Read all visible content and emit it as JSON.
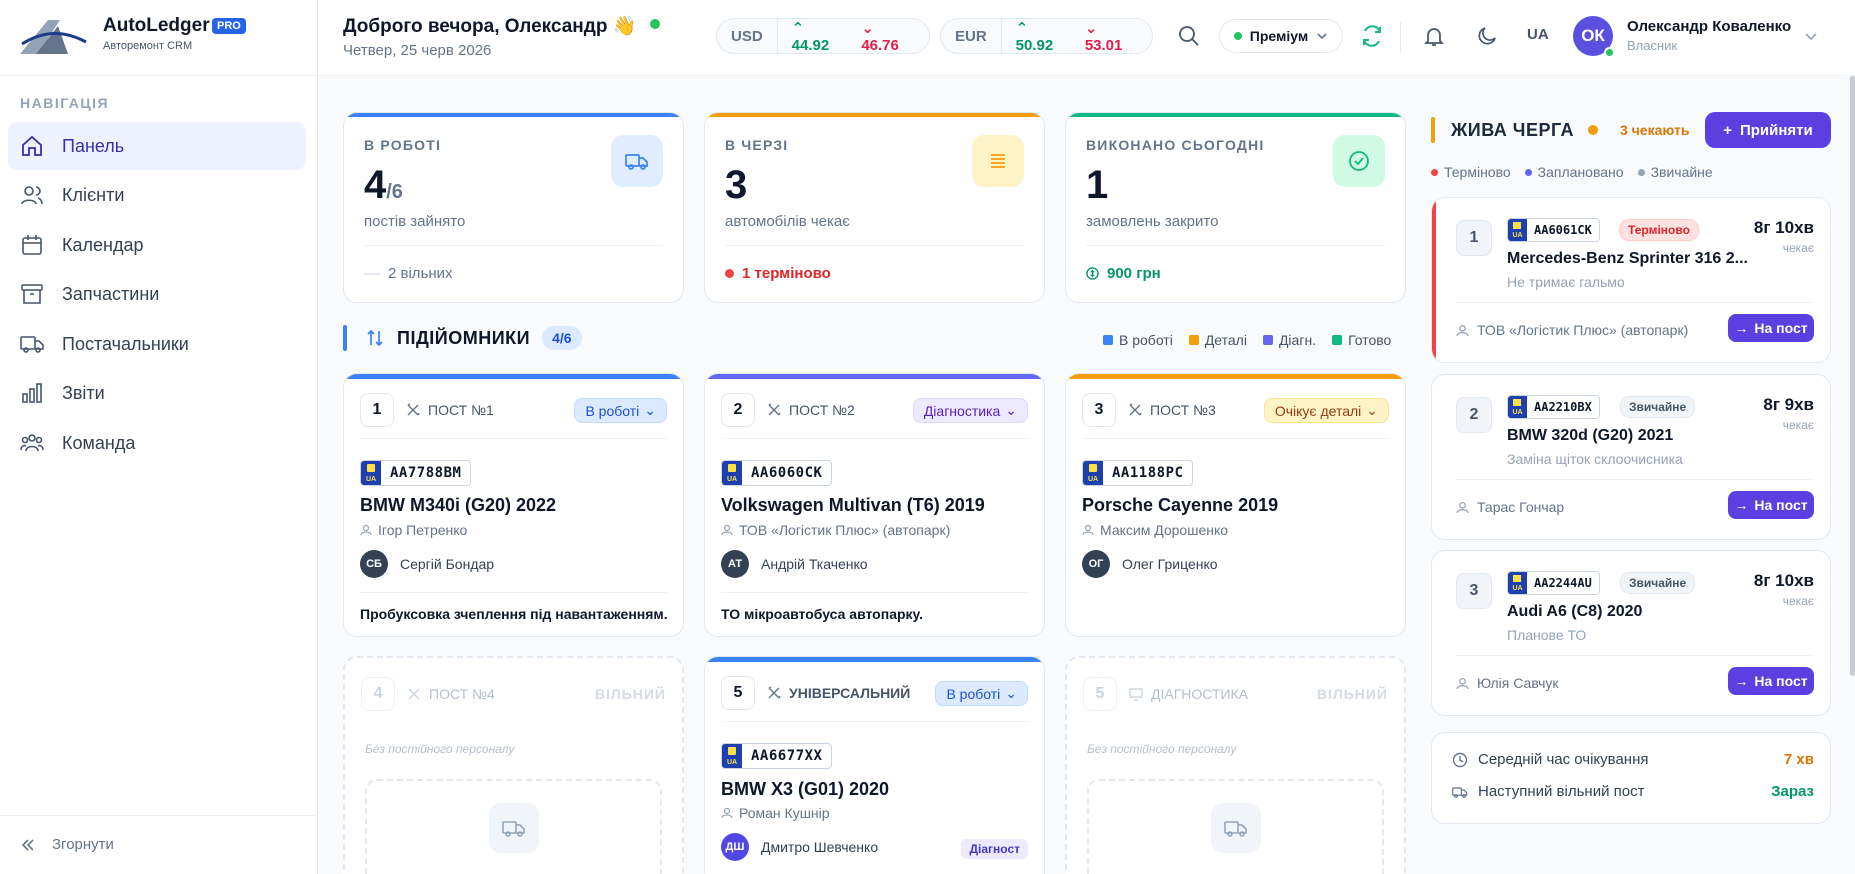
{
  "app": {
    "name": "AutoLedger",
    "badge": "PRO",
    "subtitle": "Авторемонт CRM"
  },
  "sidebar": {
    "heading": "НАВІГАЦІЯ",
    "items": [
      {
        "label": "Панель",
        "icon": "home-icon"
      },
      {
        "label": "Клієнти",
        "icon": "users-icon"
      },
      {
        "label": "Календар",
        "icon": "calendar-icon"
      },
      {
        "label": "Запчастини",
        "icon": "archive-icon"
      },
      {
        "label": "Постачальники",
        "icon": "truck-icon"
      },
      {
        "label": "Звіти",
        "icon": "chart-icon"
      },
      {
        "label": "Команда",
        "icon": "team-icon"
      }
    ],
    "collapse": "Згорнути"
  },
  "header": {
    "greeting": "Доброго вечора, Олександр",
    "wave": "👋",
    "date": "Четвер, 25 черв 2026",
    "rates": [
      {
        "code": "USD",
        "buy": "44.92",
        "sell": "46.76"
      },
      {
        "code": "EUR",
        "buy": "50.92",
        "sell": "53.01"
      }
    ],
    "plan": "Преміум",
    "lang": "UA",
    "user": {
      "initials": "ОК",
      "name": "Олександр Коваленко",
      "role": "Власник"
    }
  },
  "stats": [
    {
      "label": "В РОБОТІ",
      "value": "4",
      "total": "/6",
      "sub": "постів зайнято",
      "foot": "2 вільних"
    },
    {
      "label": "В ЧЕРЗІ",
      "value": "3",
      "sub": "автомобілів чекає",
      "foot": "1 терміново"
    },
    {
      "label": "ВИКОНАНО СЬОГОДНІ",
      "value": "1",
      "sub": "замовлень закрито",
      "foot": "900 грн"
    }
  ],
  "lifts": {
    "title": "ПІДІЙОМНИКИ",
    "count": "4/6",
    "legend": [
      "В роботі",
      "Деталі",
      "Діагн.",
      "Готово"
    ],
    "posts": [
      {
        "num": "1",
        "title": "ПОСТ №1",
        "status": "В роботі",
        "plate": "AA7788BM",
        "car": "BMW M340i (G20) 2022",
        "owner": "Ігор Петренко",
        "mech_initials": "СБ",
        "mech": "Сергій Бондар",
        "note": "Пробуксовка зчеплення під навантаженням."
      },
      {
        "num": "2",
        "title": "ПОСТ №2",
        "status": "Діагностика",
        "plate": "AA6060CK",
        "car": "Volkswagen Multivan (T6) 2019",
        "owner": "ТОВ «Логістик Плюс» (автопарк)",
        "mech_initials": "АТ",
        "mech": "Андрій Ткаченко",
        "note": "ТО мікроавтобуса автопарку."
      },
      {
        "num": "3",
        "title": "ПОСТ №3",
        "status": "Очікує деталі",
        "plate": "AA1188PC",
        "car": "Porsche Cayenne 2019",
        "owner": "Максим Дорошенко",
        "mech_initials": "ОГ",
        "mech": "Олег Гриценко"
      },
      {
        "num": "4",
        "title": "ПОСТ №4",
        "free": "ВІЛЬНИЙ",
        "nostaff": "Без постійного персоналу"
      },
      {
        "num": "5",
        "title": "УНІВЕРСАЛЬНИЙ",
        "status": "В роботі",
        "plate": "AA6677XX",
        "car": "BMW X3 (G01) 2020",
        "owner": "Роман Кушнір",
        "mech_initials": "ДШ",
        "mech": "Дмитро Шевченко",
        "tag": "Діагност"
      },
      {
        "num": "5",
        "title": "ДІАГНОСТИКА",
        "free": "ВІЛЬНИЙ",
        "nostaff": "Без постійного персоналу"
      }
    ]
  },
  "queue": {
    "title": "ЖИВА ЧЕРГА",
    "waiting": "3 чекають",
    "accept": "Прийняти",
    "legend": [
      "Терміново",
      "Заплановано",
      "Звичайне"
    ],
    "items": [
      {
        "num": "1",
        "plate": "AA6061CK",
        "badge": "Терміново",
        "time": "8г 10хв",
        "wait": "чекає",
        "car": "Mercedes-Benz Sprinter 316 2...",
        "desc": "Не тримає гальмо",
        "client": "ТОВ «Логістик Плюс» (автопарк)",
        "btn": "На пост"
      },
      {
        "num": "2",
        "plate": "AA2210BX",
        "badge": "Звичайне",
        "time": "8г 9хв",
        "wait": "чекає",
        "car": "BMW 320d (G20) 2021",
        "desc": "Заміна щіток склоочисника",
        "client": "Тарас Гончар",
        "btn": "На пост"
      },
      {
        "num": "3",
        "plate": "AA2244AU",
        "badge": "Звичайне",
        "time": "8г 10хв",
        "wait": "чекає",
        "car": "Audi A6 (C8) 2020",
        "desc": "Планове ТО",
        "client": "Юлія Савчук",
        "btn": "На пост"
      }
    ],
    "summary": [
      {
        "label": "Середній час очікування",
        "value": "7 хв"
      },
      {
        "label": "Наступний вільний пост",
        "value": "Зараз"
      }
    ]
  },
  "colors": {
    "accent": "#5b3fe0",
    "blue": "#3b82f6",
    "amber": "#f59e0b",
    "green": "#10b981",
    "purple": "#6366f1",
    "red": "#ef4444"
  }
}
